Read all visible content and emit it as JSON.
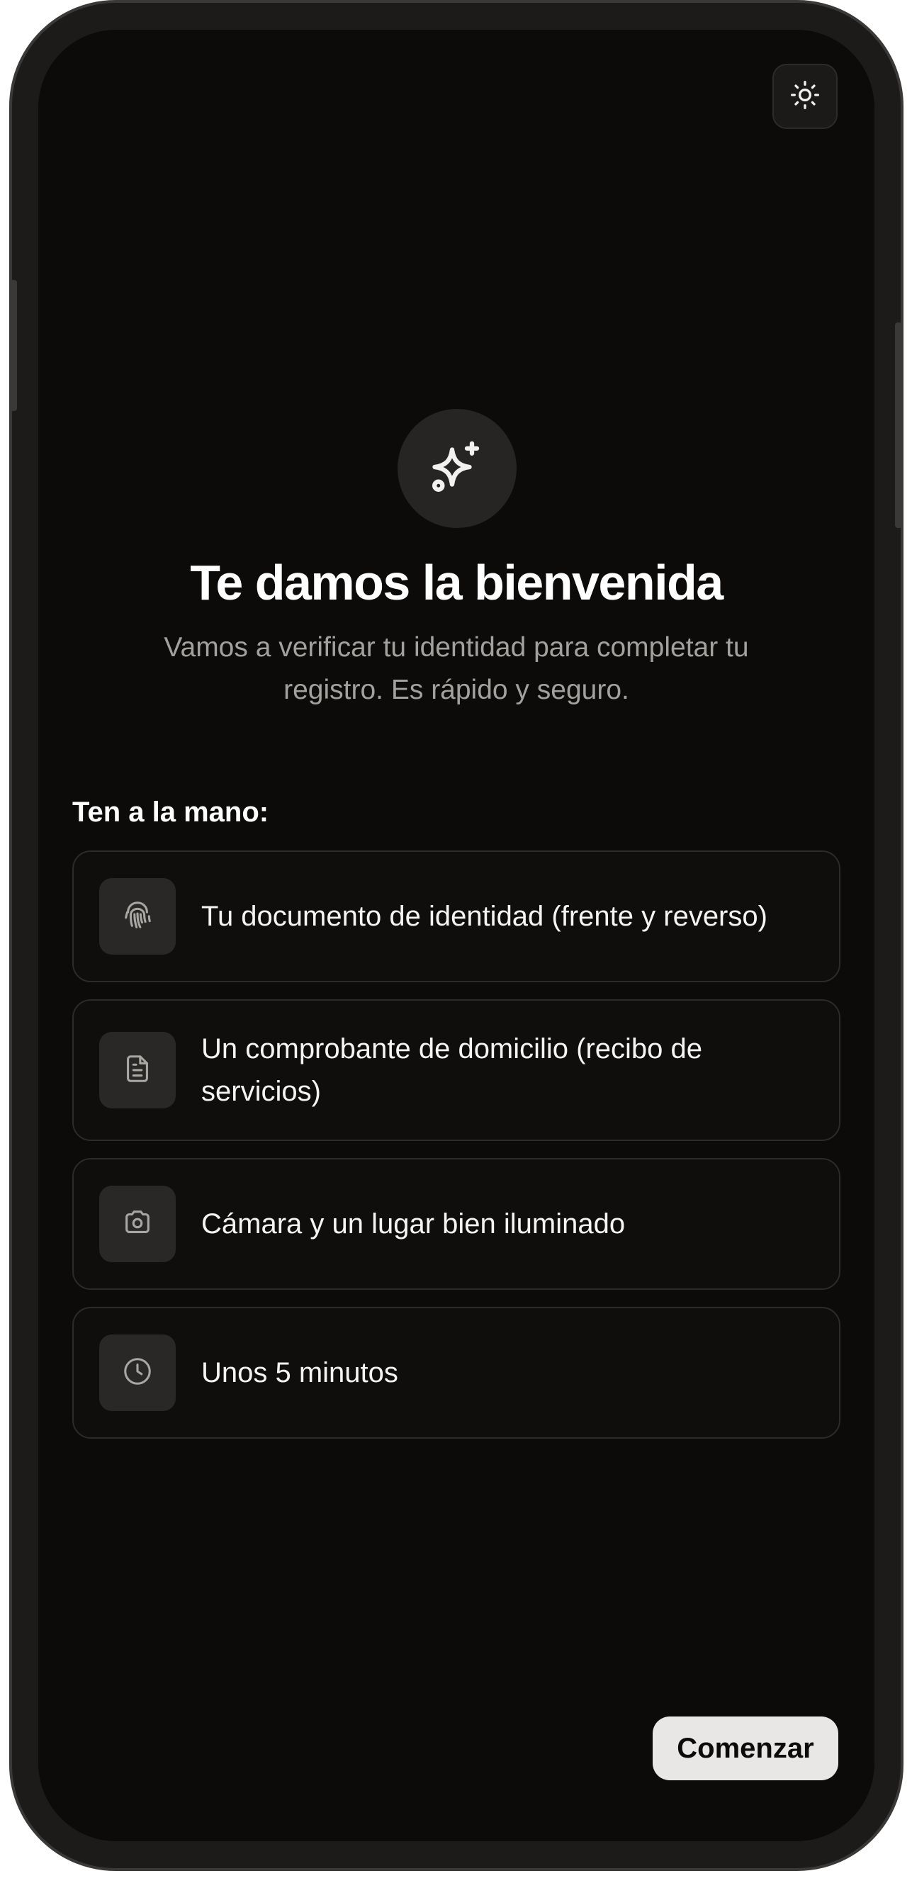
{
  "header": {
    "theme_toggle_icon": "sun-icon"
  },
  "hero": {
    "icon": "sparkles-icon",
    "title": "Te damos la bienvenida",
    "subtitle": "Vamos a verificar tu identidad para completar tu registro. Es rápido y seguro."
  },
  "checklist": {
    "label": "Ten a la mano:",
    "items": [
      {
        "icon": "fingerprint-icon",
        "text": "Tu documento de identidad (frente y reverso)"
      },
      {
        "icon": "document-icon",
        "text": "Un comprobante de domicilio (recibo de servicios)"
      },
      {
        "icon": "camera-icon",
        "text": "Cámara y un lugar bien iluminado"
      },
      {
        "icon": "clock-icon",
        "text": "Unos 5 minutos"
      }
    ]
  },
  "actions": {
    "start_label": "Comenzar"
  },
  "colors": {
    "background": "#0c0b0a",
    "card_border": "#2c2b2a",
    "icon_tile": "#2a2827",
    "primary_button": "#e8e7e5",
    "muted_text": "#a3a19e"
  }
}
